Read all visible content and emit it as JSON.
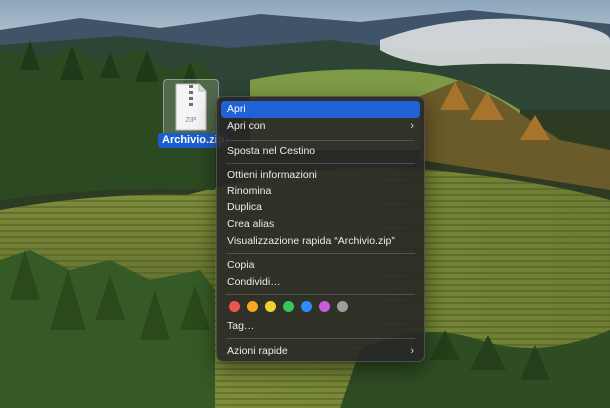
{
  "file": {
    "name": "Archivio.zip",
    "badge": "ZIP"
  },
  "context_menu": {
    "open": "Apri",
    "open_with": "Apri con",
    "move_to_trash": "Sposta nel Cestino",
    "get_info": "Ottieni informazioni",
    "rename": "Rinomina",
    "duplicate": "Duplica",
    "make_alias": "Crea alias",
    "quick_look": "Visualizzazione rapida “Archivio.zip”",
    "copy": "Copia",
    "share": "Condividi…",
    "tags": "Tag…",
    "quick_actions": "Azioni rapide",
    "submenu_glyph": "›"
  },
  "tag_colors": [
    {
      "name": "red",
      "color": "#ef5350"
    },
    {
      "name": "orange",
      "color": "#f5a623"
    },
    {
      "name": "yellow",
      "color": "#f2d22e"
    },
    {
      "name": "green",
      "color": "#35c759"
    },
    {
      "name": "blue",
      "color": "#2f8cff"
    },
    {
      "name": "purple",
      "color": "#c85bd9"
    },
    {
      "name": "gray",
      "color": "#9e9e9e"
    }
  ]
}
